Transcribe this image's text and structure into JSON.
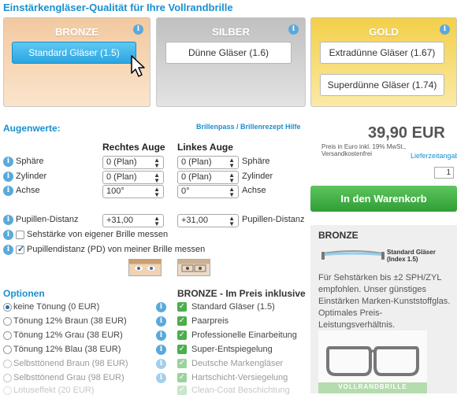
{
  "title": "Einstärkengläser-Qualität für Ihre Vollrandbrille",
  "tiers": [
    {
      "name": "BRONZE",
      "buttons": [
        "Standard Gläser (1.5)"
      ]
    },
    {
      "name": "SILBER",
      "buttons": [
        "Dünne Gläser (1.6)"
      ]
    },
    {
      "name": "GOLD",
      "buttons": [
        "Extradünne Gläser (1.67)",
        "Superdünne Gläser (1.74)"
      ]
    }
  ],
  "info_glyph": "i",
  "augenwerte": {
    "title": "Augenwerte:",
    "help_link": "Brillenpass / Brillenrezept Hilfe",
    "right_header": "Rechtes Auge",
    "left_header": "Linkes Auge",
    "rows": [
      {
        "label": "Sphäre",
        "right": "0 (Plan)",
        "left": "0 (Plan)",
        "label_right": "Sphäre"
      },
      {
        "label": "Zylinder",
        "right": "0 (Plan)",
        "left": "0 (Plan)",
        "label_right": "Zylinder"
      },
      {
        "label": "Achse",
        "right": "100°",
        "left": "0°",
        "label_right": "Achse"
      }
    ],
    "pd": {
      "label": "Pupillen-Distanz",
      "right": "+31,00",
      "left": "+31,00",
      "label_right": "Pupillen-Distanz"
    },
    "check_sehstaerke": "Sehstärke von eigener Brille messen",
    "check_pd": "Pupillendistanz (PD) von meiner Brille messen"
  },
  "price": {
    "amount": "39,90 EUR",
    "note": "Preis in Euro inkl. 19% MwSt., Versandkostenfrei",
    "delivery_link": "Lieferzeitangabe",
    "quantity": "1",
    "cart_button": "In den Warenkorb"
  },
  "panel": {
    "title": "BRONZE",
    "lens_label": "Standard Gläser (Index 1.5)",
    "text": "Für Sehstärken bis ±2 SPH/ZYL empfohlen. Unser günstiges Einstärken Marken-Kunststoffglas. Optimales Preis-Leistungsverhältnis.",
    "frame_caption": "VOLLRANDBRILLE"
  },
  "options": {
    "title": "Optionen",
    "items": [
      "keine Tönung (0 EUR)",
      "Tönung 12% Braun (38 EUR)",
      "Tönung 12% Grau (38 EUR)",
      "Tönung 12% Blau (38 EUR)",
      "Selbsttönend Braun (98 EUR)",
      "Selbsttönend Grau (98 EUR)",
      "Lotuseffekt (20 EUR)"
    ],
    "selected_index": 0
  },
  "inclusive": {
    "title": "BRONZE - Im Preis inklusive",
    "items": [
      "Standard Gläser (1.5)",
      "Paarpreis",
      "Professionelle Einarbeitung",
      "Super-Entspiegelung",
      "Deutsche Markengläser",
      "Hartschicht-Versiegelung",
      "Clean-Coat Beschichtung"
    ]
  },
  "colors": {
    "accent": "#1a8fd0",
    "cart": "#3aa83e",
    "bronze": "#f2c9a0",
    "silber": "#c8c8c8",
    "gold": "#f3cf4a"
  }
}
